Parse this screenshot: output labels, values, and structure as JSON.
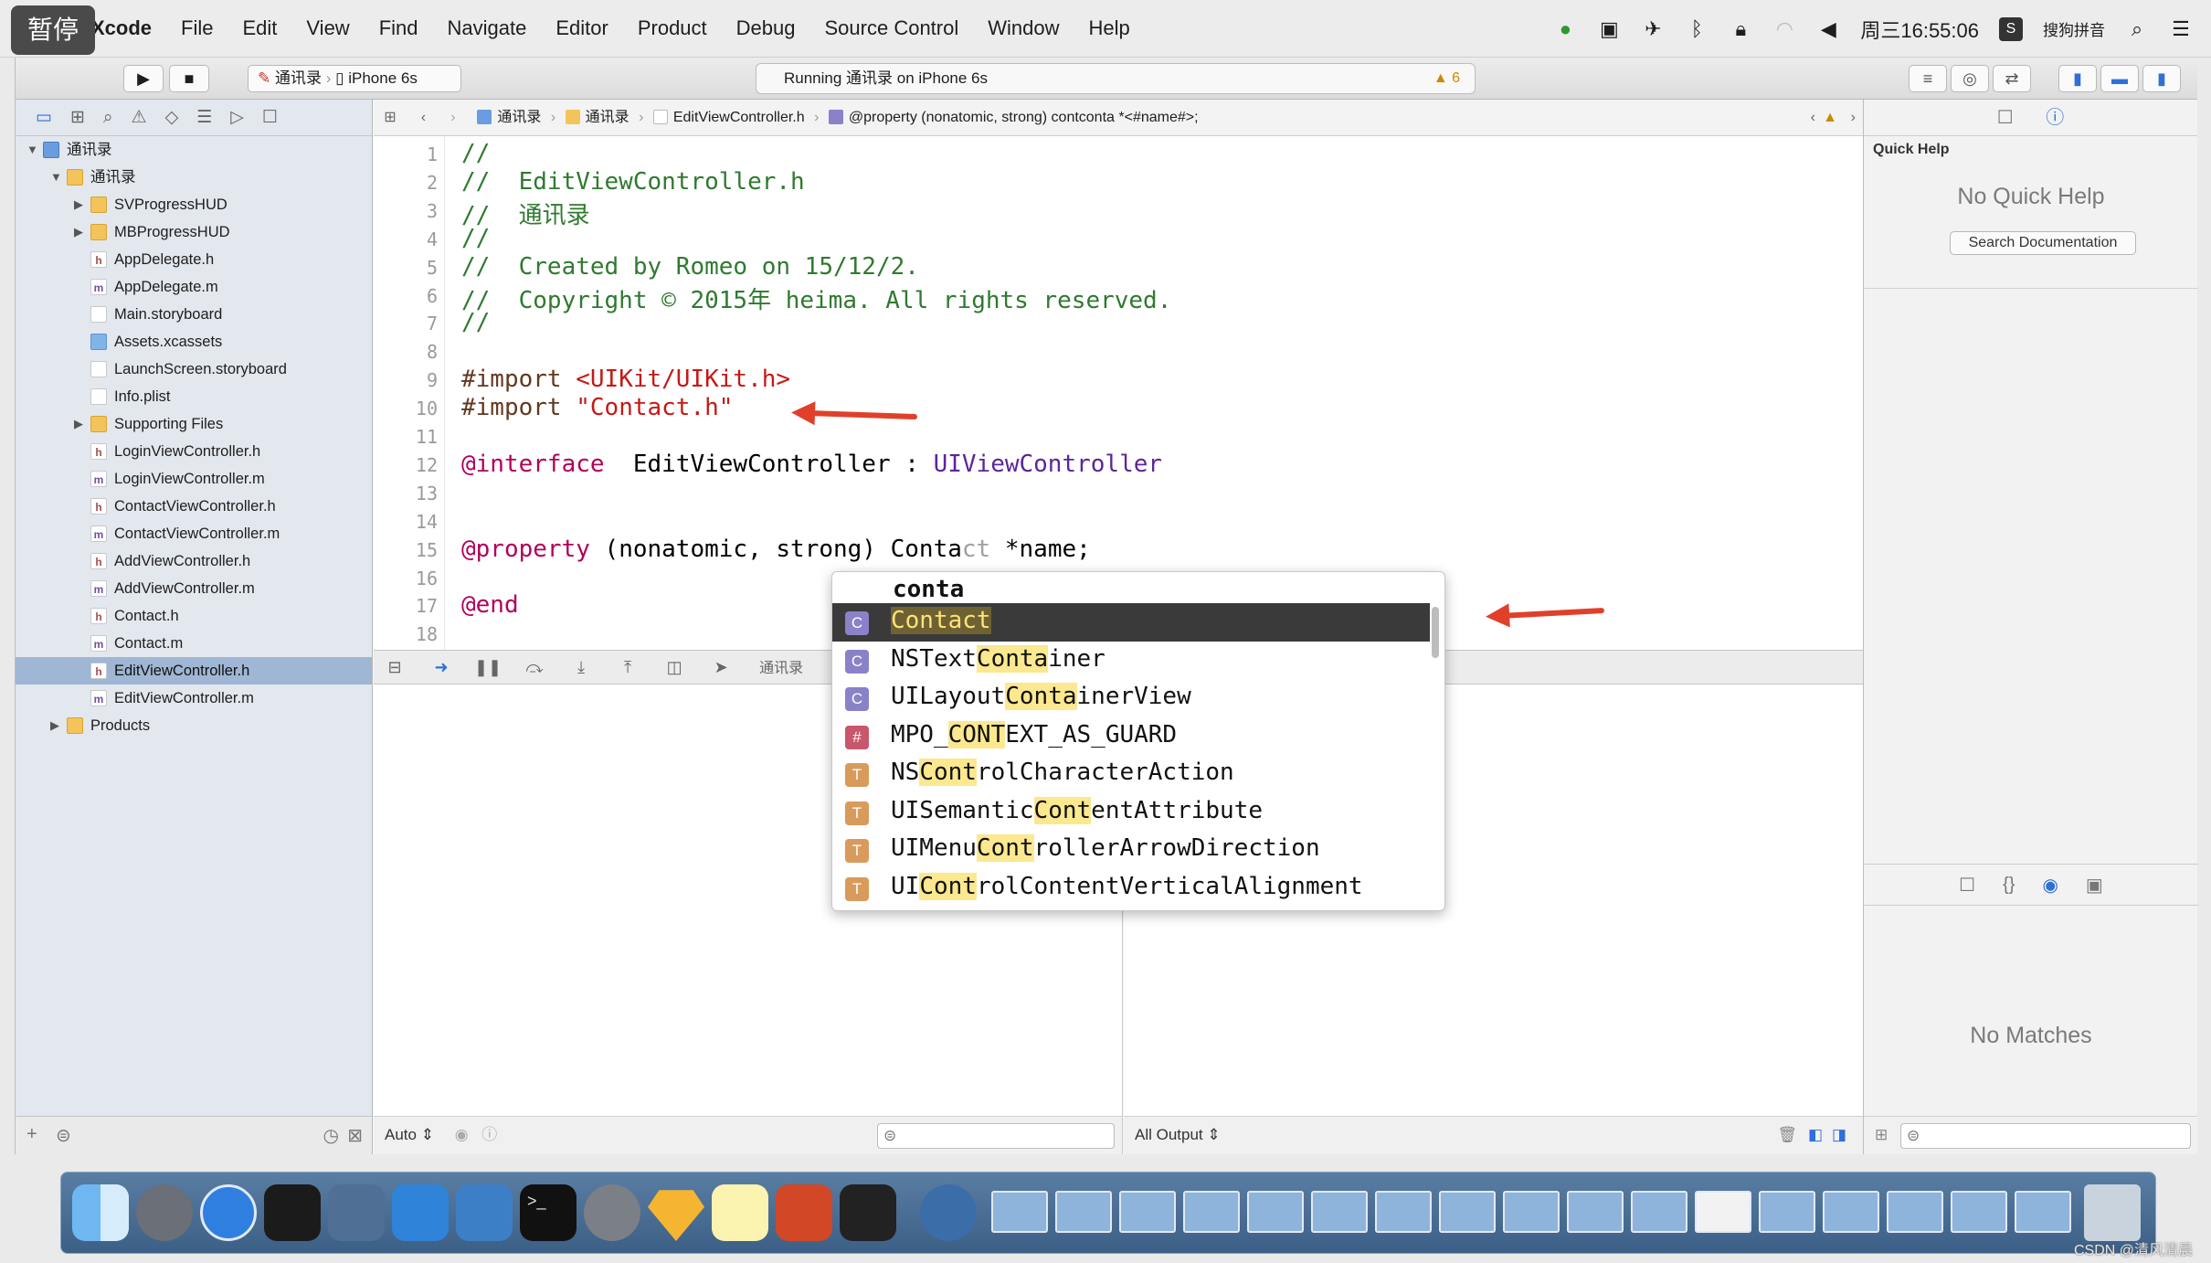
{
  "menubar": {
    "app": "Xcode",
    "items": [
      "File",
      "Edit",
      "View",
      "Find",
      "Navigate",
      "Editor",
      "Product",
      "Debug",
      "Source Control",
      "Window",
      "Help"
    ],
    "clock": "周三16:55:06",
    "input_method": "搜狗拼音"
  },
  "overlay": {
    "pause_label": "暂停"
  },
  "toolbar": {
    "scheme": "通讯录",
    "device": "iPhone 6s",
    "activity_text": "Running 通讯录 on iPhone 6s",
    "warning_count": "6"
  },
  "navigator": {
    "items": [
      {
        "label": "通讯录",
        "kind": "proj",
        "level": 0,
        "disclosure": "open"
      },
      {
        "label": "通讯录",
        "kind": "folder",
        "level": 1,
        "disclosure": "open"
      },
      {
        "label": "SVProgressHUD",
        "kind": "folder",
        "level": 2,
        "disclosure": "closed"
      },
      {
        "label": "MBProgressHUD",
        "kind": "folder",
        "level": 2,
        "disclosure": "closed"
      },
      {
        "label": "AppDelegate.h",
        "kind": "h",
        "level": 2
      },
      {
        "label": "AppDelegate.m",
        "kind": "m",
        "level": 2
      },
      {
        "label": "Main.storyboard",
        "kind": "sb",
        "level": 2
      },
      {
        "label": "Assets.xcassets",
        "kind": "xc",
        "level": 2
      },
      {
        "label": "LaunchScreen.storyboard",
        "kind": "sb",
        "level": 2
      },
      {
        "label": "Info.plist",
        "kind": "pl",
        "level": 2
      },
      {
        "label": "Supporting Files",
        "kind": "folder",
        "level": 2,
        "disclosure": "closed"
      },
      {
        "label": "LoginViewController.h",
        "kind": "h",
        "level": 2
      },
      {
        "label": "LoginViewController.m",
        "kind": "m",
        "level": 2
      },
      {
        "label": "ContactViewController.h",
        "kind": "h",
        "level": 2
      },
      {
        "label": "ContactViewController.m",
        "kind": "m",
        "level": 2
      },
      {
        "label": "AddViewController.h",
        "kind": "h",
        "level": 2
      },
      {
        "label": "AddViewController.m",
        "kind": "m",
        "level": 2
      },
      {
        "label": "Contact.h",
        "kind": "h",
        "level": 2
      },
      {
        "label": "Contact.m",
        "kind": "m",
        "level": 2
      },
      {
        "label": "EditViewController.h",
        "kind": "h",
        "level": 2,
        "selected": true
      },
      {
        "label": "EditViewController.m",
        "kind": "m",
        "level": 2
      },
      {
        "label": "Products",
        "kind": "folder",
        "level": 1,
        "disclosure": "closed"
      }
    ]
  },
  "jumpbar": {
    "crumbs": [
      "通讯录",
      "通讯录",
      "EditViewController.h",
      "@property (nonatomic, strong) contconta *<#name#>;"
    ]
  },
  "editor": {
    "lines": [
      {
        "n": "1",
        "segs": [
          [
            "cm",
            "//"
          ]
        ]
      },
      {
        "n": "2",
        "segs": [
          [
            "cm",
            "//  EditViewController.h"
          ]
        ]
      },
      {
        "n": "3",
        "segs": [
          [
            "cm",
            "//  通讯录"
          ]
        ]
      },
      {
        "n": "4",
        "segs": [
          [
            "cm",
            "//"
          ]
        ]
      },
      {
        "n": "5",
        "segs": [
          [
            "cm",
            "//  Created by Romeo on 15/12/2."
          ]
        ]
      },
      {
        "n": "6",
        "segs": [
          [
            "cm",
            "//  Copyright © 2015年 heima. All rights reserved."
          ]
        ]
      },
      {
        "n": "7",
        "segs": [
          [
            "cm",
            "//"
          ]
        ]
      },
      {
        "n": "8",
        "segs": []
      },
      {
        "n": "9",
        "segs": [
          [
            "dir",
            "#import "
          ],
          [
            "str",
            "<UIKit/UIKit.h>"
          ]
        ]
      },
      {
        "n": "10",
        "segs": [
          [
            "dir",
            "#import "
          ],
          [
            "str",
            "\"Contact.h\""
          ]
        ]
      },
      {
        "n": "11",
        "segs": []
      },
      {
        "n": "12",
        "segs": [
          [
            "kw",
            "@interface"
          ],
          [
            "",
            "  EditViewController : "
          ],
          [
            "type",
            "UIViewController"
          ]
        ]
      },
      {
        "n": "13",
        "segs": []
      },
      {
        "n": "14",
        "segs": []
      },
      {
        "n": "15",
        "segs": [
          [
            "kw",
            "@property"
          ],
          [
            "",
            " (nonatomic, strong) Conta"
          ],
          [
            "ghost",
            "ct"
          ],
          [
            "",
            " *name;"
          ]
        ]
      },
      {
        "n": "16",
        "segs": []
      },
      {
        "n": "17",
        "segs": [
          [
            "kw",
            "@end"
          ]
        ]
      },
      {
        "n": "18",
        "segs": []
      }
    ]
  },
  "debug": {
    "scheme": "通讯录",
    "vars_filter": "Auto",
    "console_filter": "All Output"
  },
  "autocomplete": {
    "typed": "conta",
    "items": [
      {
        "badge": "C",
        "color": "#8a82c8",
        "pre": "",
        "hl": "Contact",
        "post": "",
        "selected": true
      },
      {
        "badge": "C",
        "color": "#8a82c8",
        "pre": "NSText",
        "hl": "Conta",
        "post": "iner"
      },
      {
        "badge": "C",
        "color": "#8a82c8",
        "pre": "UILayout",
        "hl": "Conta",
        "post": "inerView"
      },
      {
        "badge": "#",
        "color": "#c9566a",
        "pre": "MPO_",
        "hl": "CONT",
        "post": "EXT_AS_GUARD"
      },
      {
        "badge": "T",
        "color": "#d99b5b",
        "pre": "NS",
        "hl": "Cont",
        "post": "rolCharacterAction"
      },
      {
        "badge": "T",
        "color": "#d99b5b",
        "pre": "UISemantic",
        "hl": "Cont",
        "post": "entAttribute"
      },
      {
        "badge": "T",
        "color": "#d99b5b",
        "pre": "UIMenu",
        "hl": "Cont",
        "post": "rollerArrowDirection"
      },
      {
        "badge": "T",
        "color": "#d99b5b",
        "pre": "UI",
        "hl": "Cont",
        "post": "rolContentVerticalAlignment"
      }
    ]
  },
  "utilities": {
    "title": "Quick Help",
    "no_help": "No Quick Help",
    "search_button": "Search Documentation",
    "no_matches": "No Matches"
  },
  "watermark": "CSDN @清风清晨"
}
